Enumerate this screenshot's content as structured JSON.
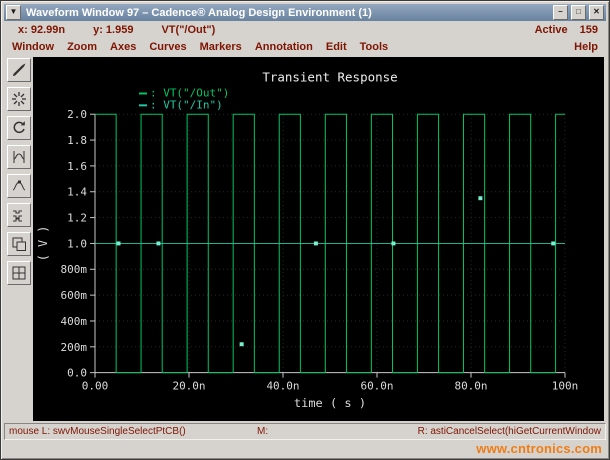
{
  "window": {
    "title": "Waveform Window 97 – Cadence® Analog Design Environment (1)",
    "icons": {
      "window_menu": "▼",
      "minimize": "–",
      "maximize": "□",
      "close": "✕"
    }
  },
  "coords": {
    "x": "x: 92.99n",
    "y": "y: 1.959",
    "trace": "VT(\"/Out\")",
    "active_label": "Active",
    "active_count": "159"
  },
  "menus": [
    "Window",
    "Zoom",
    "Axes",
    "Curves",
    "Markers",
    "Annotation",
    "Edit",
    "Tools"
  ],
  "help_menu": "Help",
  "statusbar": {
    "left": "mouse L:  swvMouseSingleSelectPtCB()",
    "middle": "M:",
    "right": "R: astiCancelSelect(hiGetCurrentWindow"
  },
  "watermark": "www.cntronics.com",
  "chart_data": {
    "type": "line",
    "title": "Transient Response",
    "xlabel": "time ( s )",
    "ylabel": "( V )",
    "xlim_ns": [
      0,
      100
    ],
    "ylim": [
      0,
      2
    ],
    "x_ticks": [
      {
        "v": 0,
        "label": "0.00"
      },
      {
        "v": 20,
        "label": "20.0n"
      },
      {
        "v": 40,
        "label": "40.0n"
      },
      {
        "v": 60,
        "label": "60.0n"
      },
      {
        "v": 80,
        "label": "80.0n"
      },
      {
        "v": 100,
        "label": "100n"
      }
    ],
    "y_ticks": [
      {
        "v": 0.0,
        "label": "0.0"
      },
      {
        "v": 0.2,
        "label": "200m"
      },
      {
        "v": 0.4,
        "label": "400m"
      },
      {
        "v": 0.6,
        "label": "600m"
      },
      {
        "v": 0.8,
        "label": "800m"
      },
      {
        "v": 1.0,
        "label": "1.0"
      },
      {
        "v": 1.2,
        "label": "1.2"
      },
      {
        "v": 1.4,
        "label": "1.4"
      },
      {
        "v": 1.6,
        "label": "1.6"
      },
      {
        "v": 1.8,
        "label": "1.8"
      },
      {
        "v": 2.0,
        "label": "2.0"
      }
    ],
    "legend": [
      {
        "label": "VT(\"/Out\")",
        "color": "#00c564"
      },
      {
        "label": "VT(\"/In\")",
        "color": "#1fc9a4"
      }
    ],
    "series": [
      {
        "name": "VT(\"/Out\")",
        "kind": "square",
        "color": "#00c564",
        "levels": [
          0,
          2
        ],
        "period_ns": 9.8,
        "high_ns": 4.5,
        "phase": "starts-high"
      },
      {
        "name": "VT(\"/In\")",
        "kind": "constant",
        "color": "#1fc9a4",
        "value": 1.0
      }
    ],
    "markers": {
      "color": "#79efcf",
      "size": 4,
      "points": [
        {
          "x": 5.0,
          "y": 1.0
        },
        {
          "x": 13.5,
          "y": 1.0
        },
        {
          "x": 31.2,
          "y": 0.22
        },
        {
          "x": 47.0,
          "y": 1.0
        },
        {
          "x": 63.5,
          "y": 1.0
        },
        {
          "x": 82.0,
          "y": 1.35
        },
        {
          "x": 97.5,
          "y": 1.0
        }
      ]
    },
    "grid": {
      "on": true,
      "style": "dotted",
      "color": "#1d2f28"
    }
  }
}
